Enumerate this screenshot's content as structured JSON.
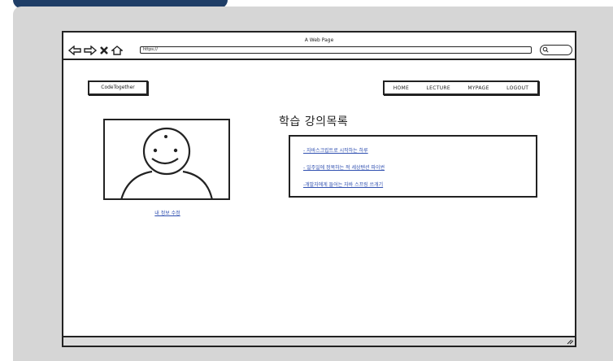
{
  "browser": {
    "window_title": "A Web Page",
    "address": "https://"
  },
  "header": {
    "logo": "CodeTogether",
    "nav": [
      "HOME",
      "LECTURE",
      "MYPAGE",
      "LOGOUT"
    ]
  },
  "profile": {
    "edit_link": "내 정보 수정"
  },
  "main": {
    "title": "학습 강의목록",
    "courses": [
      "- 자바스크립트로 시작하는 하루",
      "- 일주일에 정복하는 적 세상텐션 파이썬",
      "-개발자에게 들어는 자바 스프링 쓰개기"
    ]
  }
}
